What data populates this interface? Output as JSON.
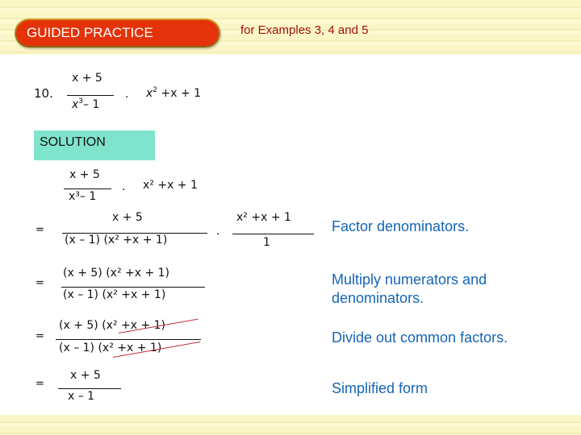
{
  "header": {
    "badge": "GUIDED PRACTICE",
    "reference": "for Examples 3, 4 and 5"
  },
  "problem": {
    "number": "10.",
    "left_numerator": "x + 5",
    "left_denominator_base": "x",
    "left_denominator_exp": "3",
    "left_denominator_rest": "– 1",
    "operator": "·",
    "right_term_base": "x",
    "right_term_exp": "2",
    "right_term_rest": " +x + 1"
  },
  "solution_label": "SOLUTION",
  "steps": [
    {
      "equals": "",
      "numerator": "x + 5",
      "denominator": "x³– 1",
      "operator": "·",
      "right": "x² +x + 1",
      "note": ""
    },
    {
      "equals": "=",
      "numerator": "x + 5",
      "denominator": "(x – 1) (x² +x + 1)",
      "operator": "·",
      "right_numerator": "x² +x + 1",
      "right_denominator": "1",
      "note": "Factor denominators."
    },
    {
      "equals": "=",
      "numerator": "(x + 5) (x² +x + 1)",
      "denominator": "(x – 1) (x² +x + 1)",
      "note": "Multiply numerators and denominators."
    },
    {
      "equals": "=",
      "numerator": "(x + 5) (x² +x + 1)",
      "denominator": "(x – 1) (x² +x + 1)",
      "note": "Divide out common factors.",
      "strike_color": "#c0303a"
    },
    {
      "equals": "=",
      "numerator": "x + 5",
      "denominator": "x – 1",
      "note": "Simplified form"
    }
  ],
  "colors": {
    "badge_bg": "#e4330b",
    "reference_text": "#a01010",
    "solution_bg": "#7fe4cc",
    "note_text": "#1565b5",
    "band_bg": "#fbf6c6"
  }
}
